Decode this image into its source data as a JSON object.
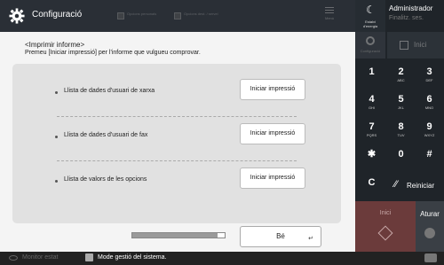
{
  "header": {
    "title": "Configuració",
    "items": [
      "Opcions personals",
      "Opcions dest. / servei"
    ],
    "menu_label": "Menú"
  },
  "main": {
    "heading": "<Imprimir informe>",
    "instruction": "Premeu [Iniciar impressió] per l'informe que vulgueu comprovar.",
    "rows": [
      {
        "label": "Llista de dades d'usuari de xarxa",
        "button": "Iniciar impressió"
      },
      {
        "label": "Llista de dades d'usuari de fax",
        "button": "Iniciar impressió"
      },
      {
        "label": "Llista de valors de les opcions",
        "button": "Iniciar impressió"
      }
    ],
    "progress": 0.92,
    "ok_button": "Bé",
    "enter_symbol": "↵"
  },
  "status": {
    "monitor_label": "Monitor estat",
    "mode_label": "Mode gestió del sistema."
  },
  "right": {
    "energy_label": "Estalvi d'energia",
    "admin": "Administrador",
    "finalitz": "Finalitz. ses.",
    "config_label": "Configuració",
    "inici_top": "Inici",
    "keys": [
      {
        "d": "1",
        "l": ""
      },
      {
        "d": "2",
        "l": "ABC"
      },
      {
        "d": "3",
        "l": "DEF"
      },
      {
        "d": "4",
        "l": "GHI"
      },
      {
        "d": "5",
        "l": "JKL"
      },
      {
        "d": "6",
        "l": "MNO"
      },
      {
        "d": "7",
        "l": "PQRS"
      },
      {
        "d": "8",
        "l": "TUV"
      },
      {
        "d": "9",
        "l": "WXYZ"
      },
      {
        "d": "✱",
        "l": ""
      },
      {
        "d": "0",
        "l": ""
      },
      {
        "d": "#",
        "l": ""
      },
      {
        "d": "C",
        "l": ""
      }
    ],
    "reiniciar": "Reiniciar",
    "start_label": "Inici",
    "stop_label": "Aturar"
  }
}
